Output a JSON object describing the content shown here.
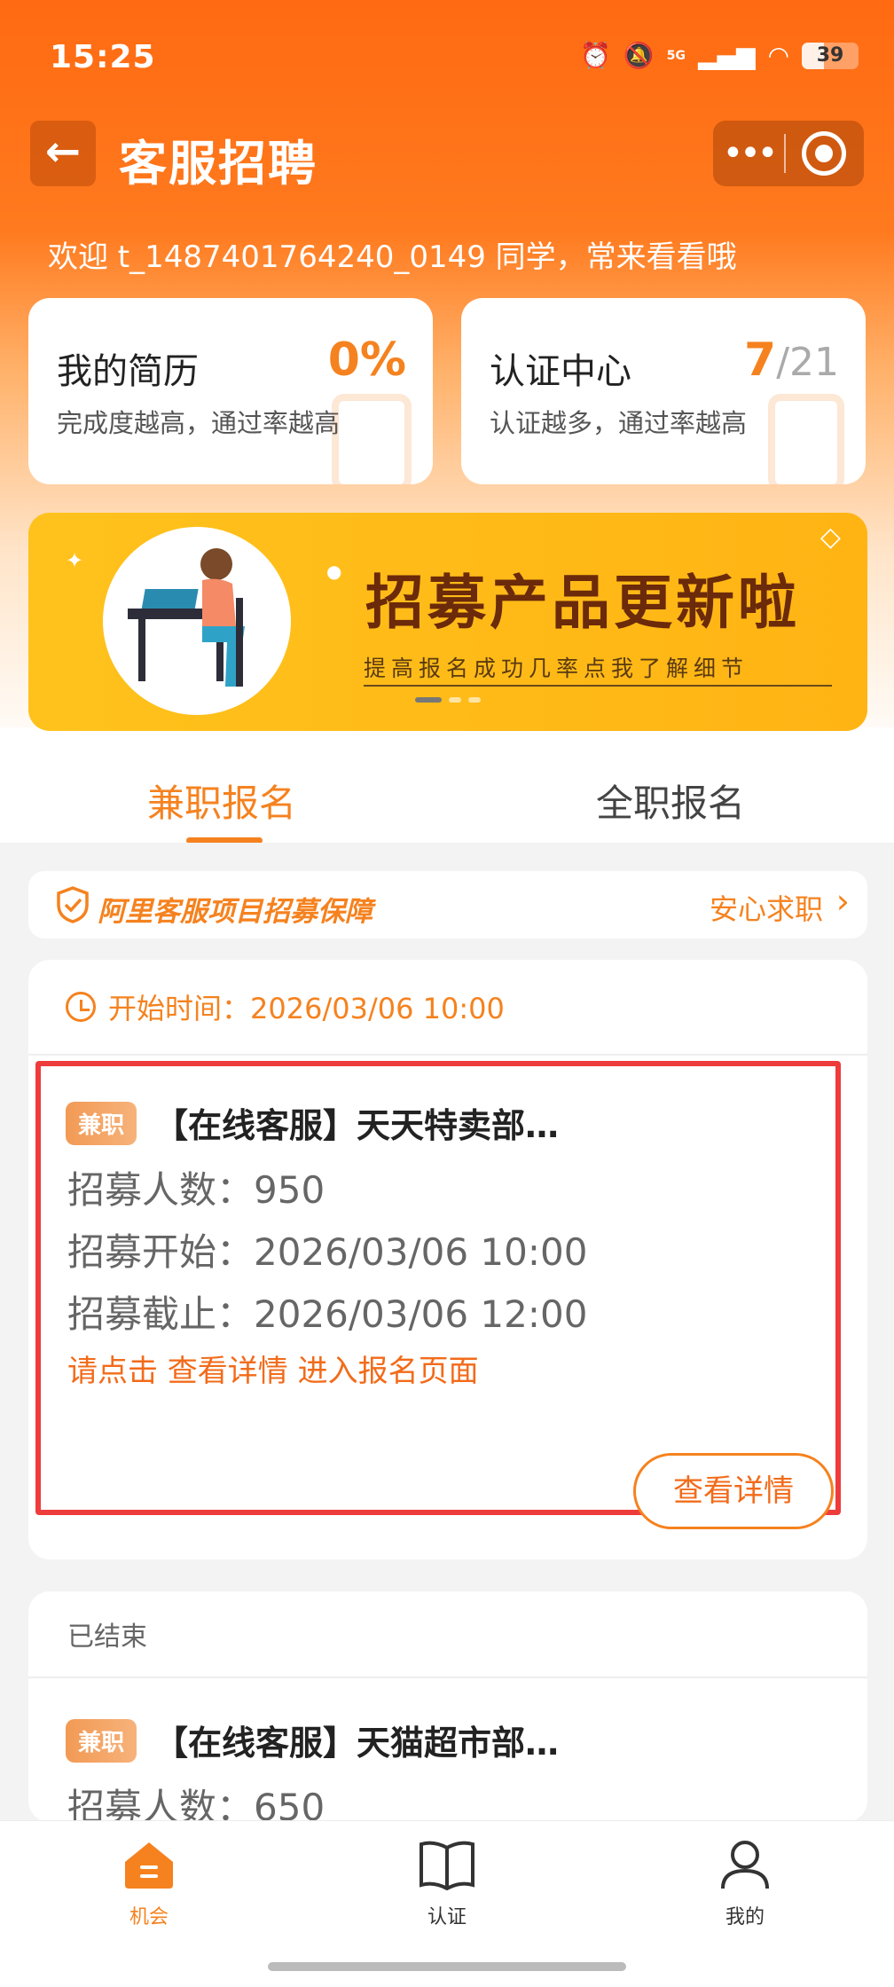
{
  "status_bar": {
    "time": "15:25",
    "network": "5G",
    "battery": "39",
    "battery_level": 0.39
  },
  "header": {
    "title": "客服招聘",
    "back_icon": "arrow-left-icon",
    "more_icon": "more-dots-icon",
    "record_icon": "record-circle-icon"
  },
  "welcome": "欢迎 t_1487401764240_0149 同学，常来看看哦",
  "cards": [
    {
      "title": "我的简历",
      "subtitle": "完成度越高，通过率越高",
      "value": "0%"
    },
    {
      "title": "认证中心",
      "subtitle": "认证越多，通过率越高",
      "value_num": "7",
      "value_den": "/21"
    }
  ],
  "banner": {
    "title": "招募产品更新啦",
    "subtitle": "提高报名成功几率点我了解细节"
  },
  "tabs": [
    {
      "label": "兼职报名",
      "active": true
    },
    {
      "label": "全职报名",
      "active": false
    }
  ],
  "guarantee": {
    "title": "阿里客服项目招募保障",
    "action": "安心求职"
  },
  "jobs": [
    {
      "start_label": "开始时间：2026/03/06 10:00",
      "tag": "兼职",
      "title": "【在线客服】天天特卖部…",
      "lines": [
        "招募人数：950",
        "招募开始：2026/03/06 10:00",
        "招募截止：2026/03/06 12:00"
      ],
      "hint": "请点击 查看详情 进入报名页面",
      "button": "查看详情"
    },
    {
      "status": "已结束",
      "tag": "兼职",
      "title": "【在线客服】天猫超市部…",
      "lines": [
        "招募人数：650"
      ]
    }
  ],
  "bottom_nav": [
    {
      "label": "机会",
      "icon": "home-icon",
      "active": true
    },
    {
      "label": "认证",
      "icon": "book-icon",
      "active": false
    },
    {
      "label": "我的",
      "icon": "user-icon",
      "active": false
    }
  ],
  "colors": {
    "accent": "#f5821f",
    "header": "#ff6a12",
    "highlight": "#ee3c3c",
    "banner": "#ffc21c"
  }
}
